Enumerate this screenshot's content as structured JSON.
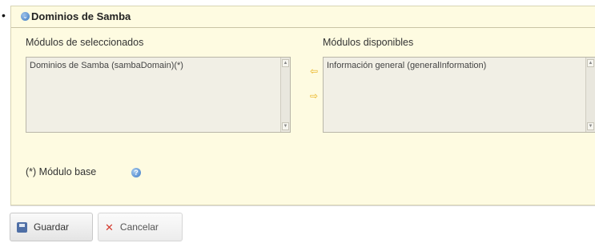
{
  "top_fragment": "",
  "panel": {
    "title": "Dominios de Samba",
    "header_icon": "chevron-down-icon"
  },
  "selected_modules": {
    "label": "Módulos de seleccionados",
    "items": [
      "Dominios de Samba (sambaDomain)(*)"
    ]
  },
  "available_modules": {
    "label": "Módulos disponibles",
    "items": [
      "Información general (generalInformation)"
    ]
  },
  "arrows": {
    "left_icon": "arrow-left-icon",
    "right_icon": "arrow-right-icon",
    "left_glyph": "⇦",
    "right_glyph": "⇨"
  },
  "note": {
    "text": "(*) Módulo base"
  },
  "buttons": {
    "save_label": "Guardar",
    "cancel_label": "Cancelar",
    "cancel_glyph": "✕"
  },
  "colors": {
    "panel_bg": "#fefbe1",
    "arrow": "#e8b21c",
    "accent": "#3d79c2",
    "cancel": "#d43b2f"
  }
}
